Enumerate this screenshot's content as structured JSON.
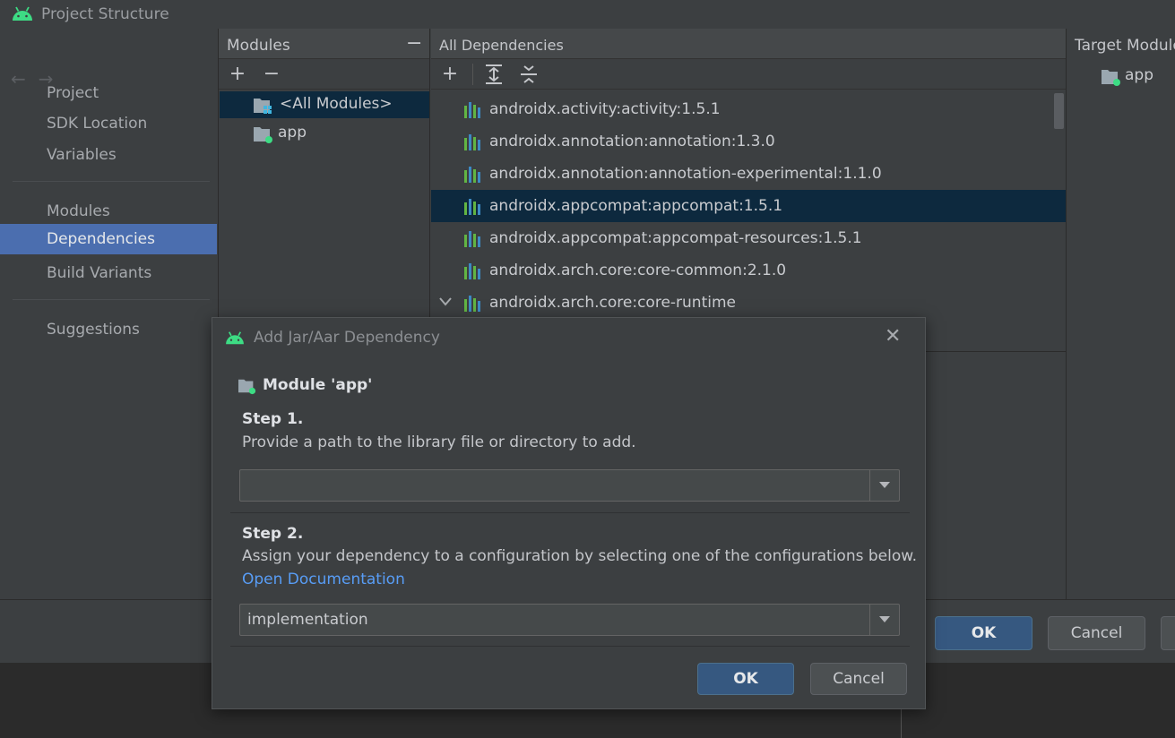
{
  "window": {
    "title": "Project Structure"
  },
  "nav": {
    "back": "←",
    "forward": "→",
    "items": [
      {
        "label": "Project"
      },
      {
        "label": "SDK Location"
      },
      {
        "label": "Variables"
      },
      {
        "label": "Modules"
      },
      {
        "label": "Dependencies"
      },
      {
        "label": "Build Variants"
      },
      {
        "label": "Suggestions"
      }
    ]
  },
  "modules_panel": {
    "header": "Modules",
    "collapse": "−",
    "add": "+",
    "remove": "−",
    "items": [
      {
        "label": "<All Modules>"
      },
      {
        "label": "app"
      }
    ]
  },
  "deps_panel": {
    "header": "All Dependencies",
    "add": "+",
    "items": [
      {
        "label": "androidx.activity:activity:1.5.1"
      },
      {
        "label": "androidx.annotation:annotation:1.3.0"
      },
      {
        "label": "androidx.annotation:annotation-experimental:1.1.0"
      },
      {
        "label": "androidx.appcompat:appcompat:1.5.1"
      },
      {
        "label": "androidx.appcompat:appcompat-resources:1.5.1"
      },
      {
        "label": "androidx.arch.core:core-common:2.1.0"
      },
      {
        "label": "androidx.arch.core:core-runtime"
      }
    ]
  },
  "target_panel": {
    "header": "Target Modules",
    "items": [
      {
        "label": "app"
      }
    ]
  },
  "footer": {
    "ok": "OK",
    "cancel": "Cancel"
  },
  "dialog": {
    "title": "Add Jar/Aar Dependency",
    "close": "✕",
    "module_label": "Module 'app'",
    "step1_title": "Step 1.",
    "step1_text": "Provide a path to the library file or directory to add.",
    "path_value": "",
    "step2_title": "Step 2.",
    "step2_text": "Assign your dependency to a configuration by selecting one of the configurations below.",
    "doc_link": "Open Documentation",
    "configuration": "implementation",
    "ok": "OK",
    "cancel": "Cancel"
  },
  "colors": {
    "android_green": "#3ddc84",
    "selection": "#4b6eaf",
    "tree_selection": "#0d293e",
    "link": "#589df6"
  }
}
